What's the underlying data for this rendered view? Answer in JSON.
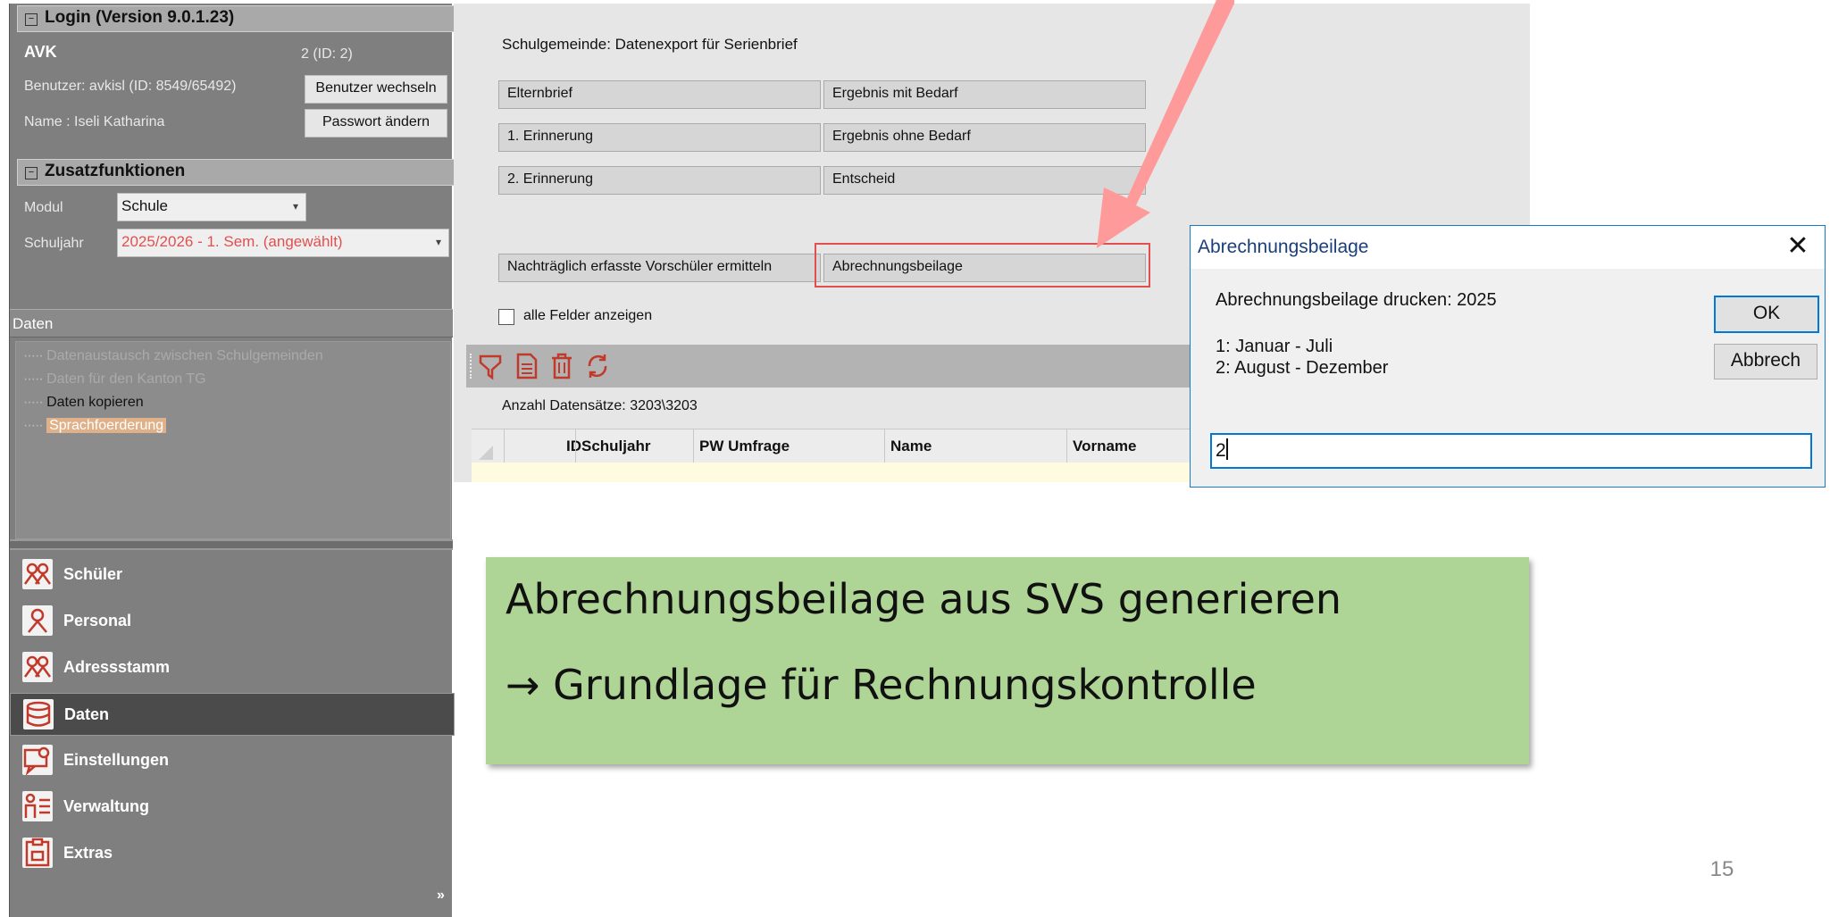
{
  "login": {
    "header": "Login (Version 9.0.1.23)",
    "org": "AVK",
    "org_id": "2 (ID: 2)",
    "user": "Benutzer: avkisl (ID: 8549/65492)",
    "name": "Name : Iseli Katharina",
    "switch_user_button": "Benutzer wechseln",
    "change_password_button": "Passwort ändern"
  },
  "zusatz": {
    "header": "Zusatzfunktionen",
    "modul_label": "Modul",
    "modul_value": "Schule",
    "schuljahr_label": "Schuljahr",
    "schuljahr_value": "2025/2026 - 1. Sem. (angewählt)"
  },
  "daten_panel": {
    "header": "Daten",
    "items": [
      {
        "label": "Datenaustausch zwischen Schulgemeinden"
      },
      {
        "label": "Daten für den Kanton TG"
      },
      {
        "label": "Daten kopieren"
      },
      {
        "label": "Sprachfoerderung"
      }
    ]
  },
  "nav": [
    {
      "label": "Schüler",
      "icon": "students-icon"
    },
    {
      "label": "Personal",
      "icon": "person-icon"
    },
    {
      "label": "Adressstamm",
      "icon": "addressbook-icon"
    },
    {
      "label": "Daten",
      "icon": "database-icon"
    },
    {
      "label": "Einstellungen",
      "icon": "settings-icon"
    },
    {
      "label": "Verwaltung",
      "icon": "admin-icon"
    },
    {
      "label": "Extras",
      "icon": "extras-icon"
    }
  ],
  "main": {
    "title": "Schulgemeinde: Datenexport für Serienbrief",
    "buttons": {
      "elternbrief": "Elternbrief",
      "ergebnis_mit": "Ergebnis mit Bedarf",
      "erinnerung1": "1. Erinnerung",
      "ergebnis_ohne": "Ergebnis ohne Bedarf",
      "erinnerung2": "2. Erinnerung",
      "entscheid": "Entscheid",
      "nachtraeglich": "Nachträglich erfasste Vorschüler ermitteln",
      "abrechnungsbeilage": "Abrechnungsbeilage"
    },
    "checkbox_label": "alle Felder anzeigen",
    "record_count": "Anzahl Datensätze: 3203\\3203",
    "columns": [
      "ID",
      "Schuljahr",
      "PW Umfrage",
      "Name",
      "Vorname"
    ]
  },
  "dialog": {
    "title": "Abrechnungsbeilage",
    "prompt": "Abrechnungsbeilage drucken: 2025",
    "option1": "1: Januar - Juli",
    "option2": "2: August - Dezember",
    "ok_button": "OK",
    "cancel_button": "Abbrech",
    "input_value": "2"
  },
  "callout": {
    "line1": "Abrechnungsbeilage aus SVS generieren",
    "line2": "→ Grundlage für Rechnungskontrolle"
  },
  "page_number": "15",
  "colors": {
    "accent_red": "#e05050",
    "arrow": "#ff9a9a",
    "callout_bg": "#aed595",
    "dialog_border": "#1979ca",
    "highlight": "#e0b088"
  }
}
